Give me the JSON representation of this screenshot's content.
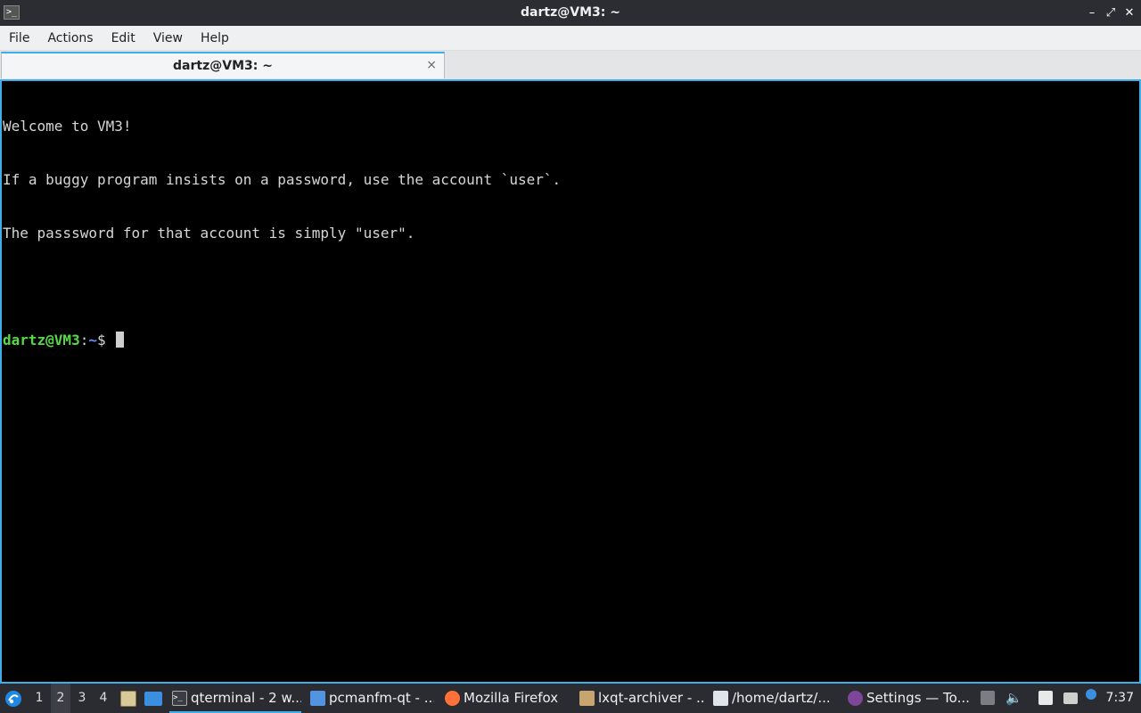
{
  "window": {
    "title": "dartz@VM3: ~",
    "app_icon": "terminal-icon",
    "minimize": "–",
    "maximize": "⤢",
    "close": "✕"
  },
  "menu": [
    "File",
    "Actions",
    "Edit",
    "View",
    "Help"
  ],
  "tab": {
    "label": "dartz@VM3: ~",
    "close": "⨯"
  },
  "terminal": {
    "lines": [
      "Welcome to VM3!",
      "If a buggy program insists on a password, use the account `user`.",
      "The passsword for that account is simply \"user\".",
      ""
    ],
    "prompt_user": "dartz@VM3",
    "prompt_sep": ":",
    "prompt_path": "~",
    "prompt_symbol": "$ "
  },
  "taskbar": {
    "desktops": [
      "1",
      "2",
      "3",
      "4"
    ],
    "active_desktop": "2",
    "tasks": [
      {
        "label": "qterminal - 2 w...",
        "icon": "terminal-icon",
        "color": "#3a3d44"
      },
      {
        "label": "pcmanfm-qt - ...",
        "icon": "folder-icon",
        "color": "#5294e2"
      },
      {
        "label": "Mozilla Firefox",
        "icon": "firefox-icon",
        "color": "#ff7139"
      },
      {
        "label": "lxqt-archiver - ...",
        "icon": "archive-icon",
        "color": "#c8a46e"
      },
      {
        "label": "/home/dartz/...",
        "icon": "text-editor-icon",
        "color": "#dfe3ea"
      },
      {
        "label": "Settings — To...",
        "icon": "tor-icon",
        "color": "#7d4698"
      }
    ],
    "clock": "7:37"
  },
  "colors": {
    "accent": "#3daee9",
    "prompt_user": "#55d945",
    "prompt_path": "#6b8bff"
  }
}
